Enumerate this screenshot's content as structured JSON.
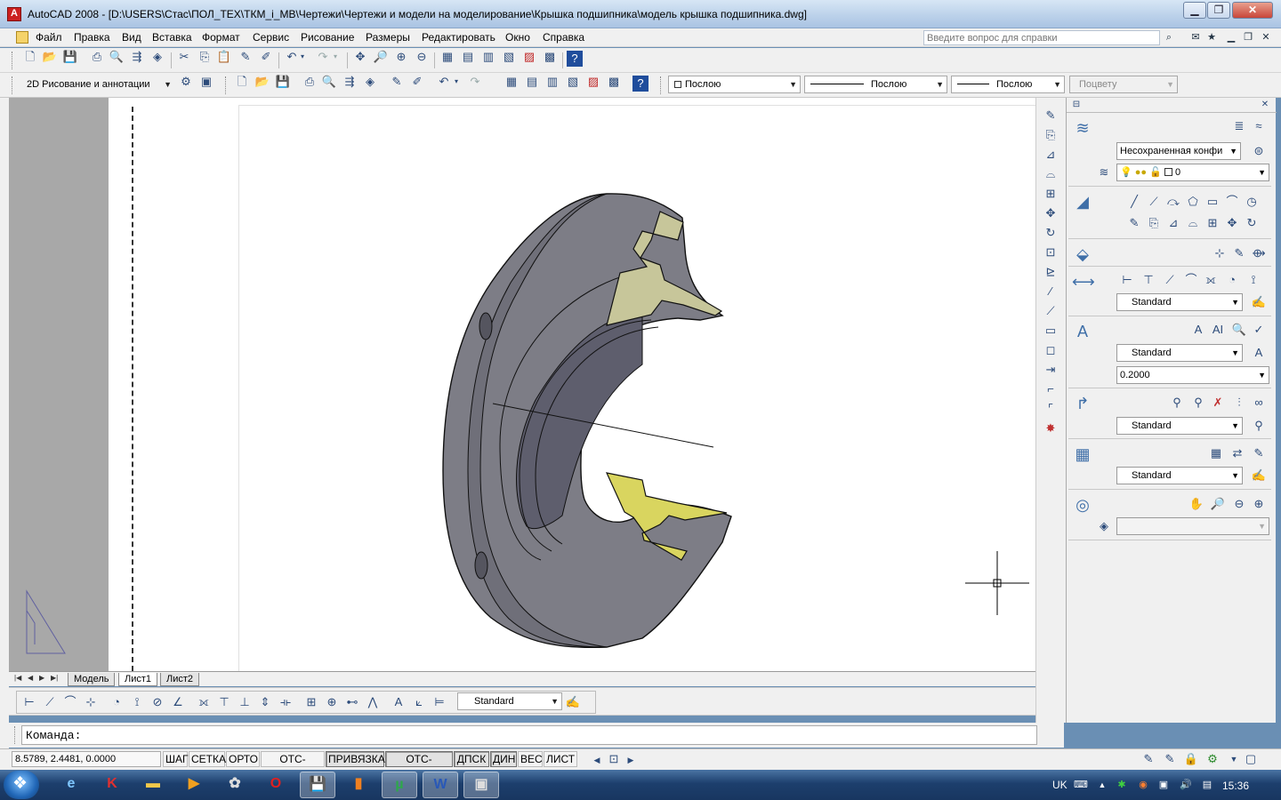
{
  "window": {
    "title": "AutoCAD 2008 - [D:\\USERS\\Стас\\ПОЛ_ТЕХ\\ТКМ_i_МВ\\Чертежи\\Чертежи и модели на моделирование\\Крышка подшипника\\модель крышка подшипника.dwg]",
    "minimize": "▁",
    "restore": "❐",
    "close": "✕"
  },
  "menu": {
    "items": [
      "Файл",
      "Правка",
      "Вид",
      "Вставка",
      "Формат",
      "Сервис",
      "Рисование",
      "Размеры",
      "Редактировать",
      "Окно",
      "Справка"
    ],
    "help_placeholder": "Введите вопрос для справки"
  },
  "toolbar2": {
    "workspace": "2D Рисование и аннотации",
    "layer_color": "Послою",
    "linetype": "Послою",
    "lineweight": "Послою",
    "plotstyle": "Поцвету"
  },
  "icons": {
    "toolbar1": [
      "new-icon",
      "open-icon",
      "save-icon",
      "plot-icon",
      "preview-icon",
      "publish-icon",
      "3d-dwf-icon",
      "cut-icon",
      "copy-icon",
      "paste-icon",
      "match-properties-icon",
      "block-editor-icon",
      "undo-icon",
      "redo-icon",
      "pan-icon",
      "zoom-realtime-icon",
      "zoom-window-icon",
      "zoom-previous-icon",
      "properties-icon",
      "design-center-icon",
      "tool-palettes-icon",
      "sheet-set-icon",
      "markup-icon",
      "quickcalc-icon",
      "help-icon"
    ],
    "right_strip": [
      "erase-icon",
      "copy-object-icon",
      "mirror-icon",
      "offset-icon",
      "array-icon",
      "move-icon",
      "rotate-icon",
      "scale-icon",
      "stretch-icon",
      "trim-icon",
      "extend-icon",
      "break-icon",
      "join-icon",
      "chamfer-icon",
      "fillet-icon",
      "explode-icon"
    ]
  },
  "tabs": [
    "Модель",
    "Лист1",
    "Лист2"
  ],
  "dim_toolbar": {
    "style": "Standard"
  },
  "command": {
    "prompt": "Команда:"
  },
  "status": {
    "coords": "8.5789, 2.4481, 0.0000",
    "buttons": [
      {
        "label": "ШАГ",
        "on": false
      },
      {
        "label": "СЕТКА",
        "on": false
      },
      {
        "label": "ОРТО",
        "on": false
      },
      {
        "label": "ОТС-ПОЛЯР",
        "on": false
      },
      {
        "label": "ПРИВЯЗКА",
        "on": true
      },
      {
        "label": "ОТС-ОБЪЕКТ",
        "on": true
      },
      {
        "label": "ДПСК",
        "on": true
      },
      {
        "label": "ДИН",
        "on": true
      },
      {
        "label": "ВЕС",
        "on": false
      },
      {
        "label": "ЛИСТ",
        "on": false
      }
    ]
  },
  "dashboard": {
    "layer_state": "Несохраненная конфи",
    "layer_name": "0",
    "dim_style": "Standard",
    "text_style": "Standard",
    "text_height": "0.2000",
    "mleader_style": "Standard",
    "table_style": "Standard",
    "render_preset": ""
  },
  "taskbar": {
    "lang": "UK",
    "clock": "15:36"
  }
}
